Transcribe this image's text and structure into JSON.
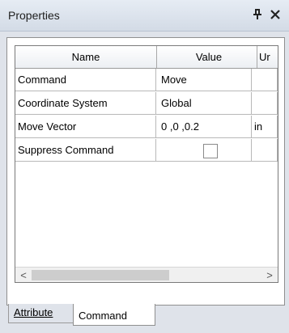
{
  "panel": {
    "title": "Properties",
    "pin_icon": "pin-icon",
    "close_icon": "close-icon"
  },
  "grid": {
    "columns": [
      "Name",
      "Value",
      "Ur"
    ],
    "rows": [
      {
        "name": "Command",
        "value": "Move",
        "unit": ""
      },
      {
        "name": "Coordinate System",
        "value": "Global",
        "unit": ""
      },
      {
        "name": "Move Vector",
        "value": "0 ,0 ,0.2",
        "unit": "in"
      },
      {
        "name": "Suppress Command",
        "value": "",
        "unit": "",
        "checkbox": false
      }
    ],
    "scroll_left": "<",
    "scroll_right": ">"
  },
  "tabs": [
    {
      "label": "Attribute",
      "active": false
    },
    {
      "label": "Command",
      "active": true
    }
  ]
}
